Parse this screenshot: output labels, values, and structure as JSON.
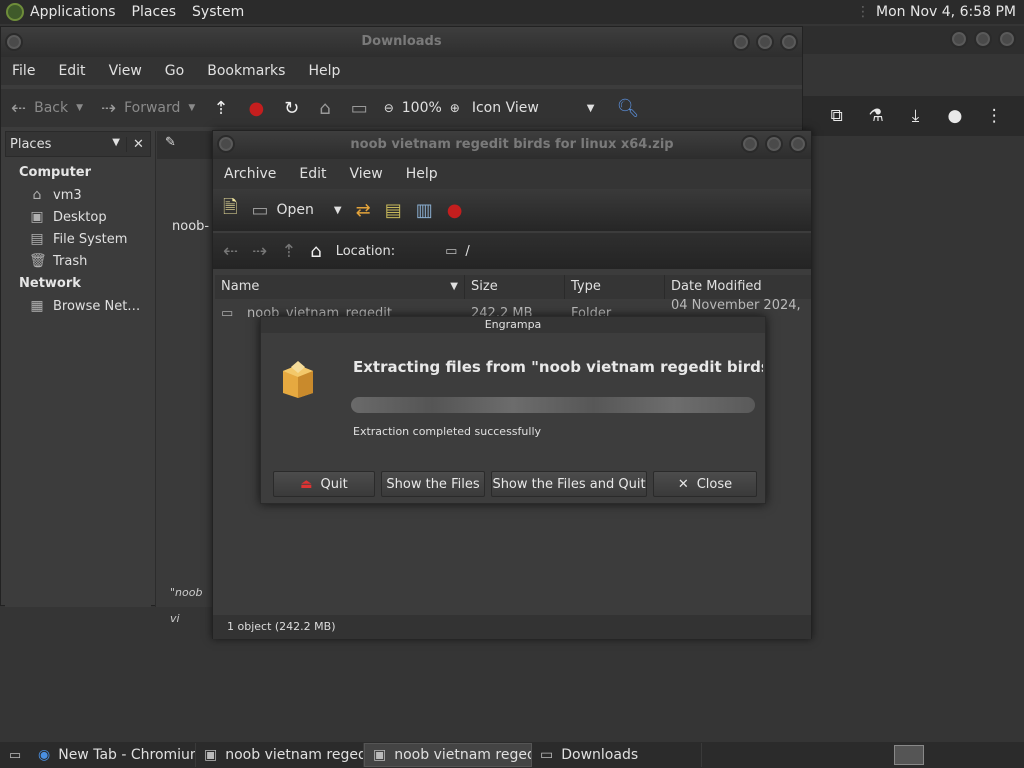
{
  "top_panel": {
    "menus": [
      "Applications",
      "Places",
      "System"
    ],
    "clock": "Mon Nov  4,  6:58 PM"
  },
  "downloads_window": {
    "title": "Downloads",
    "menu": [
      "File",
      "Edit",
      "View",
      "Go",
      "Bookmarks",
      "Help"
    ],
    "toolbar": {
      "back": "Back",
      "forward": "Forward",
      "zoom": "100%",
      "view_mode": "Icon View"
    },
    "places_label": "Places",
    "places": {
      "computer_heading": "Computer",
      "computer_items": [
        "vm3",
        "Desktop",
        "File System",
        "Trash"
      ],
      "network_heading": "Network",
      "network_items": [
        "Browse Net…"
      ]
    },
    "item_label": "noob-",
    "status": "\"noob vi"
  },
  "archive_window": {
    "title": "noob vietnam regedit birds for linux x64.zip",
    "menu": [
      "Archive",
      "Edit",
      "View",
      "Help"
    ],
    "toolbar": {
      "open_label": "Open"
    },
    "location_label": "Location:",
    "location_value": "/",
    "columns": [
      "Name",
      "Size",
      "Type",
      "Date Modified"
    ],
    "row": {
      "name": "noob_vietnam_regedit",
      "size": "242.2 MB",
      "type": "Folder",
      "date": "04 November 2024, …"
    },
    "status": "1 object (242.2 MB)"
  },
  "dialog": {
    "title": "Engrampa",
    "heading": "Extracting files from \"noob vietnam regedit birds for …",
    "status": "Extraction completed successfully",
    "progress": 1.0,
    "buttons": {
      "quit": "Quit",
      "show_files": "Show the Files",
      "show_and_quit": "Show the Files and Quit",
      "close": "Close"
    }
  },
  "taskbar": {
    "items": [
      "New Tab - Chromium",
      "noob vietnam reged…",
      "noob vietnam reged…",
      "Downloads"
    ]
  }
}
